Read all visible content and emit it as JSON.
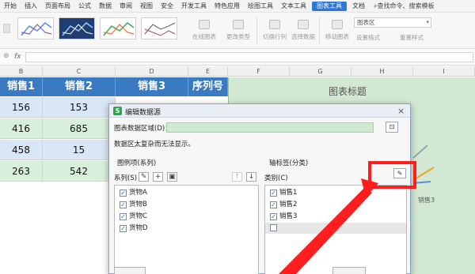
{
  "menu": {
    "items": [
      "开始",
      "插入",
      "页面布局",
      "公式",
      "数据",
      "审阅",
      "视图",
      "安全",
      "开发工具",
      "特色应用",
      "绘图工具",
      "文本工具",
      "图表工具",
      "文档"
    ],
    "active_index": 12,
    "search_placeholder": "查找命令、搜索模板"
  },
  "ribbon": {
    "buttons": [
      "在线图表",
      "更改类型",
      "切换行列",
      "选择数据",
      "移动图表"
    ],
    "chart_element_combo": "图表区",
    "format_labels": [
      "设置格式",
      "重置样式"
    ]
  },
  "columns": [
    "B",
    "C",
    "D",
    "E",
    "F",
    "G",
    "H",
    "I"
  ],
  "table": {
    "headers": [
      "销售1",
      "销售2",
      "销售3",
      "序列号"
    ],
    "rows": [
      [
        "156",
        "153"
      ],
      [
        "416",
        "685"
      ],
      [
        "458",
        "15"
      ],
      [
        "263",
        "542"
      ]
    ]
  },
  "chart": {
    "title": "图表标题",
    "legend_item": "销售3"
  },
  "dialog": {
    "title": "编辑数据源",
    "range_label": "图表数据区域(D)：",
    "range_value": "",
    "info": "数据区太复杂而无法显示。",
    "legend_group": "图例项(系列)",
    "series_label": "系列(S)",
    "series": [
      "货物A",
      "货物B",
      "货物C",
      "货物D"
    ],
    "axis_group": "轴标签(分类)",
    "category_label": "类别(C)",
    "categories": [
      "销售1",
      "销售2",
      "销售3"
    ]
  },
  "colors": {
    "table_header": "#3a7ac0",
    "row_blue": "#d9e6f5",
    "row_green": "#d8efdc",
    "chart_bg": "#d2e8d2",
    "highlight": "#ff1e1e"
  }
}
